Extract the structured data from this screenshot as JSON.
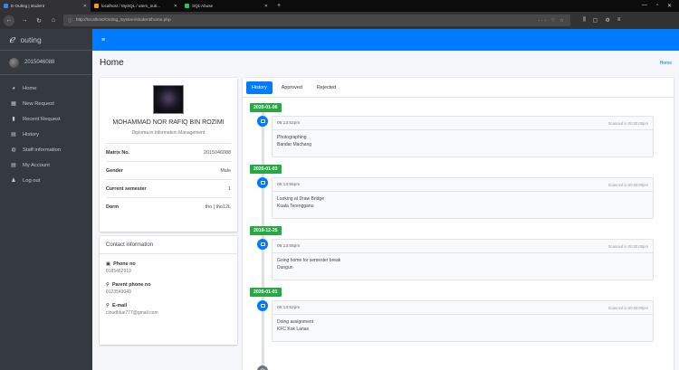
{
  "browser": {
    "tabs": [
      {
        "title": "E-Outing | student",
        "icon_color": "#3b82f6",
        "active": true
      },
      {
        "title": "localhost / MySQL / utem_outi...",
        "icon_color": "#f59e0b",
        "active": false
      },
      {
        "title": "SQL Abuse",
        "icon_color": "#22c55e",
        "active": false
      }
    ],
    "url": "http://localhost/Outing_System/student/home.php"
  },
  "sidebar": {
    "brand": "outing",
    "user_id": "2015046088",
    "items": [
      {
        "label": "Home",
        "icon": "dashboard-icon"
      },
      {
        "label": "New Request",
        "icon": "grid-icon"
      },
      {
        "label": "Recent Request",
        "icon": "file-icon"
      },
      {
        "label": "History",
        "icon": "book-icon"
      },
      {
        "label": "Staff information",
        "icon": "users-icon"
      },
      {
        "label": "My Account",
        "icon": "book-icon"
      },
      {
        "label": "Log out",
        "icon": "user-icon"
      }
    ]
  },
  "header": {
    "title": "Home",
    "breadcrumb": "Home"
  },
  "profile": {
    "name": "MOHAMMAD NOR RAFIQ BIN ROZIMI",
    "course": "Diploma in Information Management",
    "rows": [
      {
        "label": "Matrix No.",
        "value": "2015046088"
      },
      {
        "label": "Gender",
        "value": "Male"
      },
      {
        "label": "Current semester",
        "value": "1"
      },
      {
        "label": "Dorm",
        "value": "tho | tho12L"
      }
    ]
  },
  "contact": {
    "title": "Contact information",
    "items": [
      {
        "label": "Phone no",
        "value": "0185462919",
        "icon": "phone-icon"
      },
      {
        "label": "Parent phone no",
        "value": "0123549049",
        "icon": "map-marker-icon"
      },
      {
        "label": "E-mail",
        "value": "cloudblue777@gmail.com",
        "icon": "map-marker-icon"
      }
    ]
  },
  "history": {
    "tabs": [
      "History",
      "Approved",
      "Rejected"
    ],
    "status_text": "Scanned in 00:00:00pm",
    "entries": [
      {
        "date": "2020-01-06",
        "time": "06:13:52pm",
        "activity": "Photographing",
        "place": "Bandar Machang"
      },
      {
        "date": "2020-01-03",
        "time": "06:13:55pm",
        "activity": "Looking at Draw Bridge",
        "place": "Kuala Terengganu"
      },
      {
        "date": "2019-12-25",
        "time": "06:13:55pm",
        "activity": "Going home for semester break",
        "place": "Dungun"
      },
      {
        "date": "2020-01-01",
        "time": "06:13:52pm",
        "activity": "Doing assignment",
        "place": "KFC Kok Lanas"
      }
    ]
  },
  "colors": {
    "primary": "#007bff",
    "success": "#28a745",
    "sidebar": "#343a40",
    "content_bg": "#f4f6f9"
  }
}
